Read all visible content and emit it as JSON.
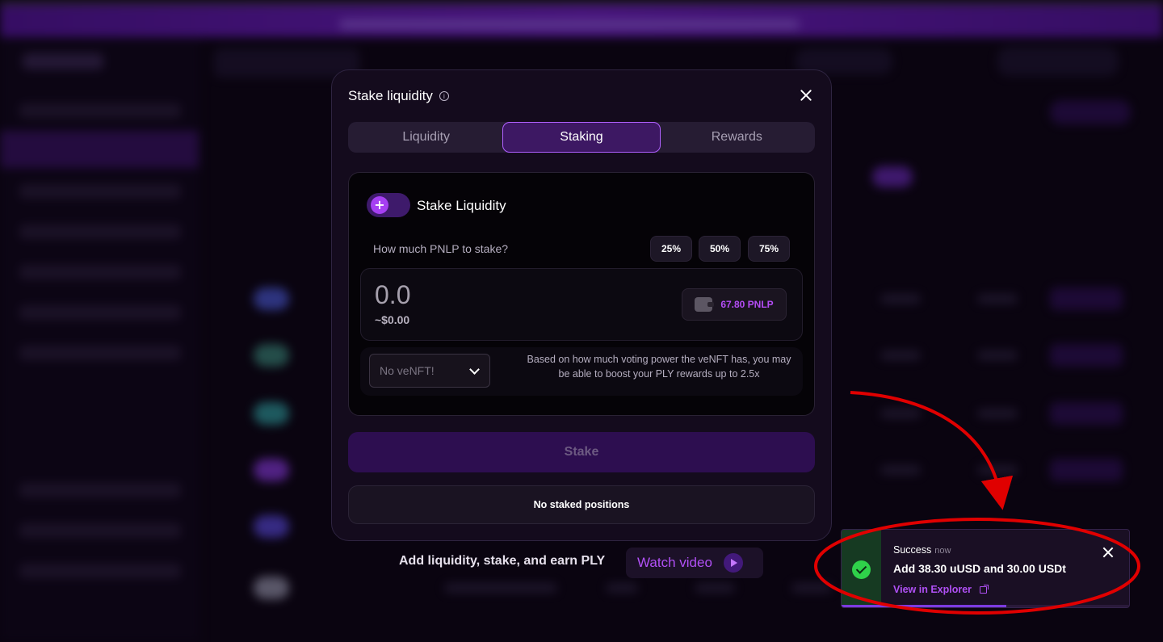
{
  "modal": {
    "title": "Stake liquidity",
    "info_icon": "info-icon",
    "close_icon": "close-icon",
    "tabs": [
      {
        "label": "Liquidity",
        "active": false
      },
      {
        "label": "Staking",
        "active": true
      },
      {
        "label": "Rewards",
        "active": false
      }
    ],
    "stake_toggle_label": "Stake Liquidity",
    "stake_toggle_icon": "plus-icon",
    "amount_prompt": "How much PNLP to stake?",
    "percent_buttons": [
      "25%",
      "50%",
      "75%"
    ],
    "amount_value": "0.0",
    "amount_usd": "~$0.00",
    "wallet_icon": "wallet-icon",
    "balance": "67.80 PNLP",
    "venft_select": "No veNFT!",
    "venft_note": "Based on how much voting power the veNFT has, you may be able to boost your PLY rewards up to 2.5x",
    "stake_button": "Stake",
    "no_positions": "No staked positions"
  },
  "promo": {
    "text": "Add liquidity, stake, and earn PLY",
    "watch_label": "Watch video",
    "play_icon": "play-icon"
  },
  "toast": {
    "title": "Success",
    "time": "now",
    "message": "Add 38.30 uUSD and 30.00 USDt",
    "link": "View in Explorer",
    "status_icon": "check-circle-icon",
    "progress": 0.57
  },
  "colors": {
    "accent": "#b050f5",
    "banner": "#7a22d6",
    "success": "#2fd14a",
    "annotation": "#e00000"
  }
}
